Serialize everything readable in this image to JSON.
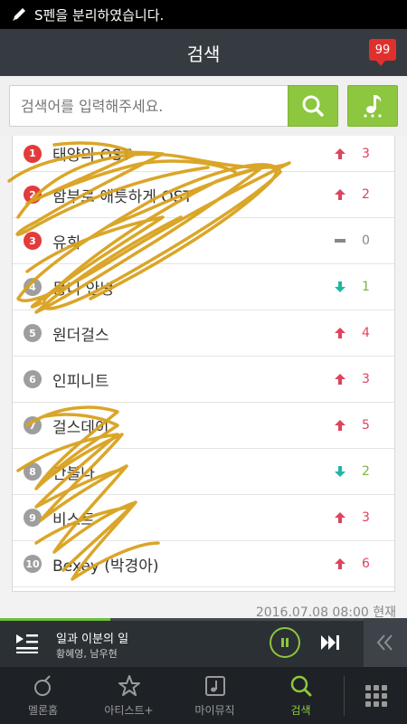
{
  "status_bar": {
    "message": "S펜을 분리하였습니다."
  },
  "header": {
    "title": "검색",
    "notification_count": "99"
  },
  "search": {
    "placeholder": "검색어를 입력해주세요."
  },
  "chart": {
    "rows": [
      {
        "rank": "1",
        "name": "태양의 OST",
        "direction": "up",
        "change": "3"
      },
      {
        "rank": "2",
        "name": "함부로 애틋하게 OST",
        "direction": "up",
        "change": "2"
      },
      {
        "rank": "3",
        "name": "유희",
        "direction": "same",
        "change": "0"
      },
      {
        "rank": "4",
        "name": "몽니 안녕",
        "direction": "down",
        "change": "1"
      },
      {
        "rank": "5",
        "name": "원더걸스",
        "direction": "up",
        "change": "4"
      },
      {
        "rank": "6",
        "name": "인피니트",
        "direction": "up",
        "change": "3"
      },
      {
        "rank": "7",
        "name": "걸스데이",
        "direction": "up",
        "change": "5"
      },
      {
        "rank": "8",
        "name": "간불나",
        "direction": "down",
        "change": "2"
      },
      {
        "rank": "9",
        "name": "비스트",
        "direction": "up",
        "change": "3"
      },
      {
        "rank": "10",
        "name": "Bexey (박경아)",
        "direction": "up",
        "change": "6"
      }
    ]
  },
  "timestamp": "2016.07.08 08:00 현재",
  "player": {
    "title": "일과 이분의 일",
    "artist": "황혜영, 남우현",
    "progress": 0.27
  },
  "tabs": [
    {
      "label": "멜론홈",
      "icon": "melon-home-icon",
      "active": false
    },
    {
      "label": "아티스트+",
      "icon": "star-icon",
      "active": false
    },
    {
      "label": "마이뮤직",
      "icon": "my-music-icon",
      "active": false
    },
    {
      "label": "검색",
      "icon": "search-icon",
      "active": true
    }
  ],
  "colors": {
    "accent": "#8dc63f",
    "up": "#e0435c",
    "down": "#1fb7a8",
    "same": "#888888",
    "header": "#353b40"
  }
}
